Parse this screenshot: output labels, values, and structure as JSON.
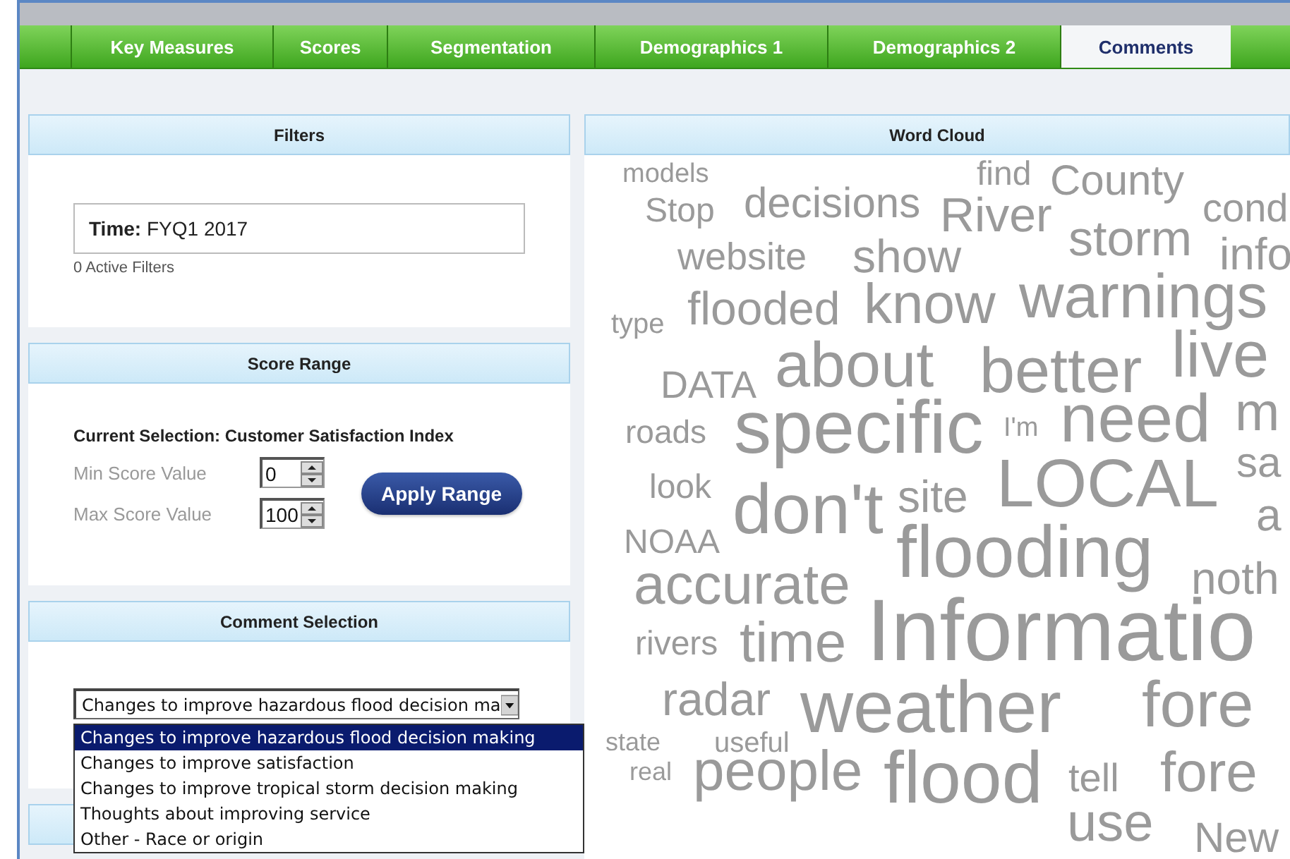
{
  "tabs": [
    {
      "label": "Key Measures",
      "selected": false
    },
    {
      "label": "Scores",
      "selected": false
    },
    {
      "label": "Segmentation",
      "selected": false
    },
    {
      "label": "Demographics 1",
      "selected": false
    },
    {
      "label": "Demographics 2",
      "selected": false
    },
    {
      "label": "Comments",
      "selected": true
    }
  ],
  "filters": {
    "title": "Filters",
    "time_label": "Time:",
    "time_value": "FYQ1 2017",
    "active_filters": "0 Active Filters"
  },
  "score_range": {
    "title": "Score Range",
    "current_selection": "Current Selection: Customer Satisfaction Index",
    "min_label": "Min Score Value",
    "min_value": "0",
    "max_label": "Max Score Value",
    "max_value": "100",
    "apply_button": "Apply Range"
  },
  "comment_selection": {
    "title": "Comment Selection",
    "dropdown_value": "Changes to improve hazardous flood decision ma",
    "options": [
      {
        "label": "Changes to improve hazardous flood decision making",
        "selected": true
      },
      {
        "label": "Changes to improve satisfaction",
        "selected": false
      },
      {
        "label": "Changes to improve tropical storm decision making",
        "selected": false
      },
      {
        "label": "Thoughts about improving service",
        "selected": false
      },
      {
        "label": "Other - Race or origin",
        "selected": false
      }
    ]
  },
  "word_cloud": {
    "title": "Word Cloud",
    "words": [
      "models",
      "find",
      "County",
      "Stop",
      "decisions",
      "River",
      "cond",
      "website",
      "show",
      "storm",
      "info",
      "type",
      "flooded",
      "know",
      "warnings",
      "DATA",
      "about",
      "better",
      "live",
      "roads",
      "specific",
      "I'm",
      "need",
      "m",
      "look",
      "site",
      "LOCAL",
      "sa",
      "don't",
      "a",
      "NOAA",
      "accurate",
      "flooding",
      "noth",
      "rivers",
      "time",
      "Informatio",
      "radar",
      "weather",
      "fore",
      "state",
      "useful",
      "real",
      "people",
      "flood",
      "tell",
      "fore",
      "use",
      "New"
    ]
  }
}
